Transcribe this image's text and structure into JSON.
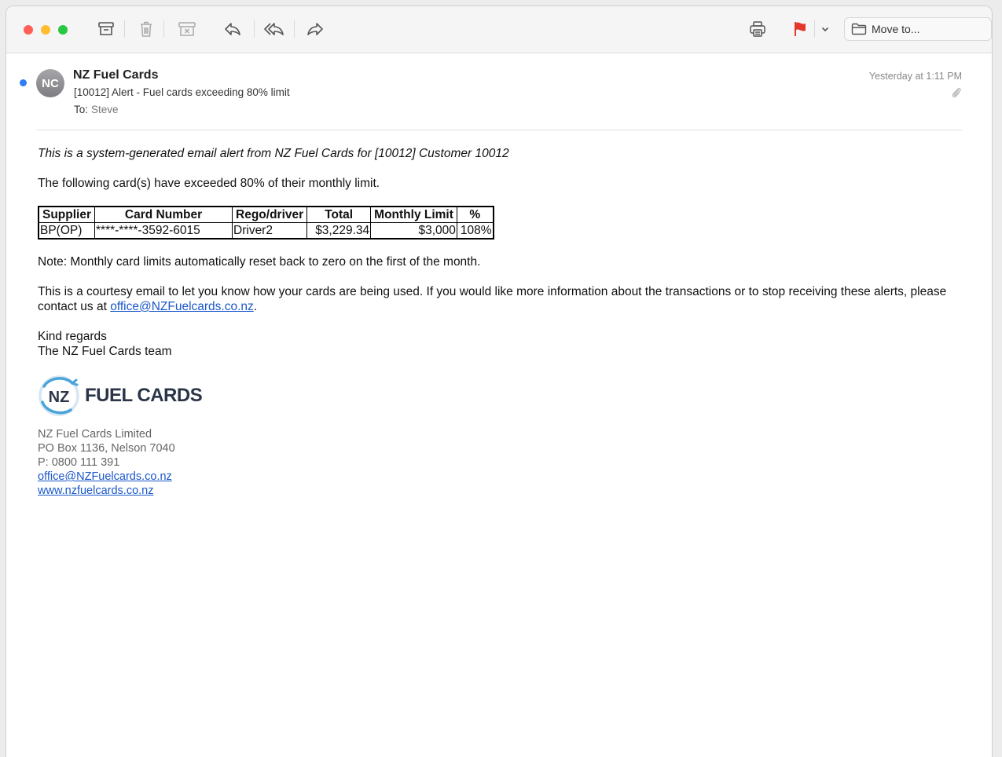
{
  "toolbar": {
    "move_to_label": "Move to...",
    "flag_color": "#e5362c"
  },
  "message": {
    "avatar_initials": "NC",
    "sender": "NZ Fuel Cards",
    "subject": "[10012] Alert - Fuel cards exceeding 80% limit",
    "to_label": "To:",
    "to_name": "Steve",
    "date": "Yesterday at 1:11 PM"
  },
  "body": {
    "intro": "This is a system-generated email alert from NZ Fuel Cards for [10012] Customer 10012",
    "exceeded_text": "The following card(s) have exceeded 80% of their monthly limit.",
    "table": {
      "headers": [
        "Supplier",
        "Card Number",
        "Rego/driver",
        "Total",
        "Monthly Limit",
        "%"
      ],
      "rows": [
        [
          "BP(OP)",
          "****-****-3592-6015",
          "Driver2",
          "$3,229.34",
          "$3,000",
          "108%"
        ]
      ]
    },
    "note": "Note: Monthly card limits automatically reset back to zero on the first of the month.",
    "courtesy_text": "This is a courtesy email to let you know how your cards are being used. If you would like more information about the transactions or to stop receiving these alerts, please contact us at",
    "courtesy_email": "office@NZFuelcards.co.nz",
    "courtesy_end": ".",
    "regards": "Kind regards",
    "team": "The NZ Fuel Cards team"
  },
  "signature": {
    "logo_nz": "NZ",
    "logo_word": "FUEL CARDS",
    "company": "NZ Fuel Cards Limited",
    "address": "PO Box 1136, Nelson 7040",
    "phone": "P: 0800 111 391",
    "email": "office@NZFuelcards.co.nz",
    "website": "www.nzfuelcards.co.nz"
  }
}
